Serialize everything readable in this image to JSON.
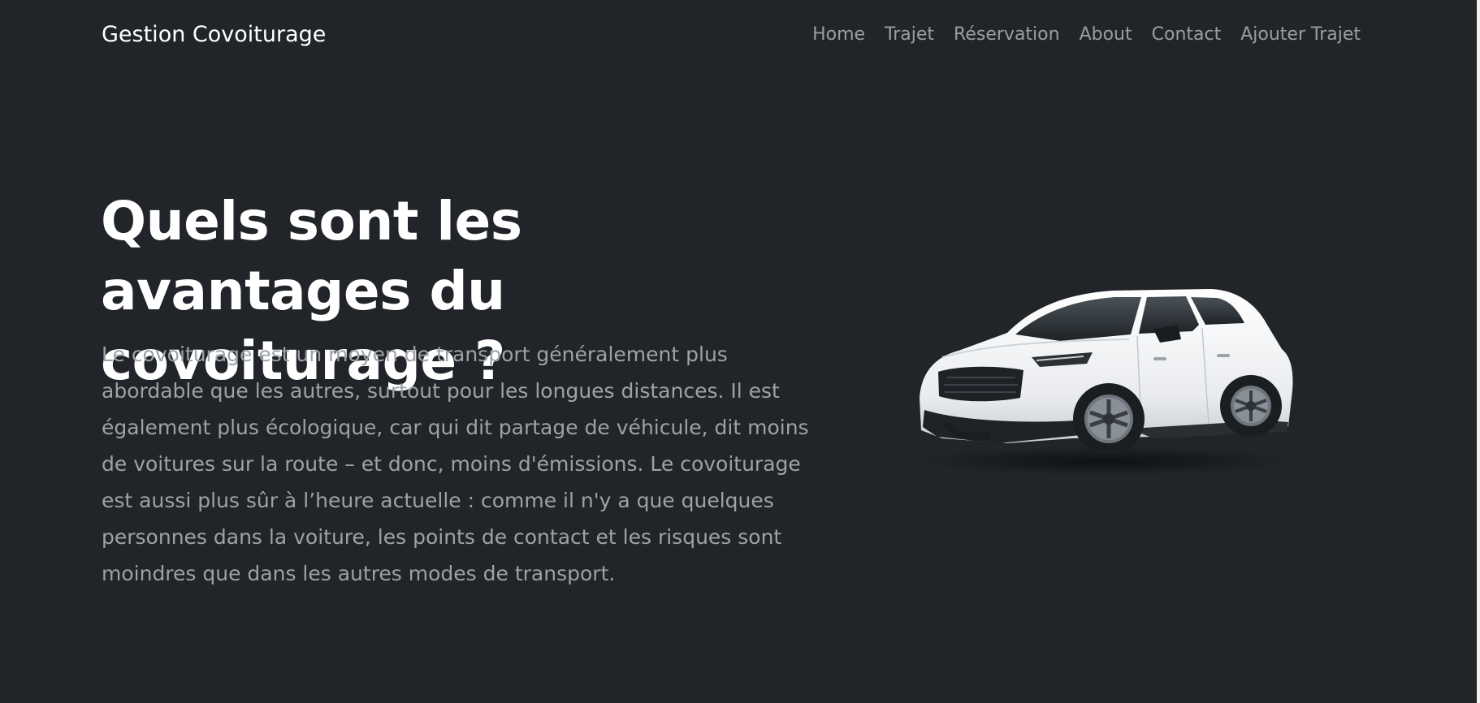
{
  "navbar": {
    "brand": "Gestion Covoiturage",
    "links": [
      {
        "label": "Home"
      },
      {
        "label": "Trajet"
      },
      {
        "label": "Réservation"
      },
      {
        "label": "About"
      },
      {
        "label": "Contact"
      },
      {
        "label": "Ajouter Trajet"
      }
    ]
  },
  "hero": {
    "title": "Quels sont les avantages du covoiturage ?",
    "lead": "Le covoiturage est un moyen de transport généralement plus abordable que les autres, surtout pour les longues distances. Il est également plus écologique, car qui dit partage de véhicule, dit moins de voitures sur la route – et donc, moins d'émissions. Le covoiturage est aussi plus sûr à l’heure actuelle : comme il n'y a que quelques personnes dans la voiture, les points de contact et les risques sont moindres que dans les autres modes de transport.",
    "image": "white-suv-car"
  },
  "colors": {
    "background": "#212529",
    "nav_link": "rgba(255,255,255,0.55)",
    "lead_text": "#9ea2a7",
    "heading": "#ffffff"
  }
}
